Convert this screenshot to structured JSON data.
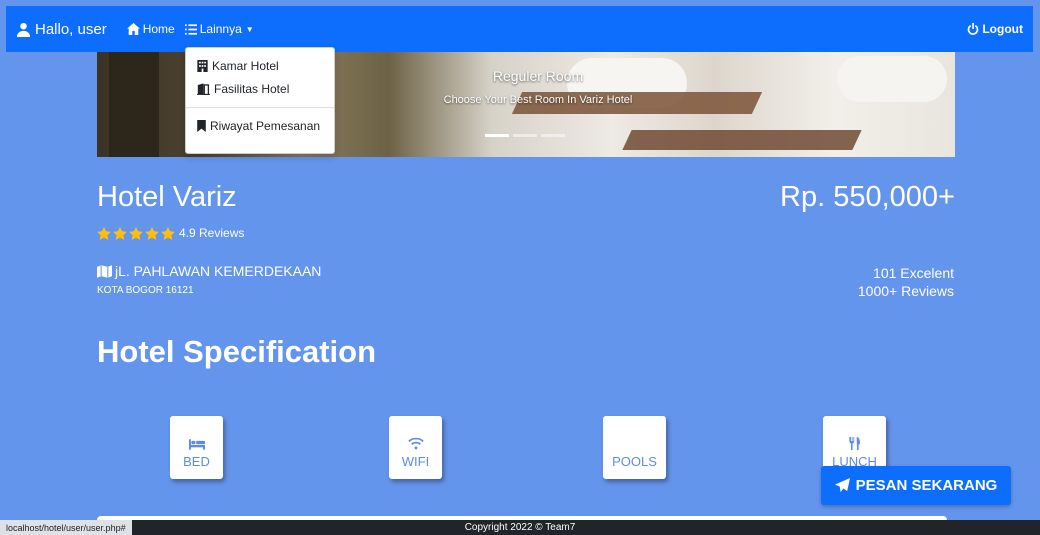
{
  "navbar": {
    "brand": "Hallo, user",
    "home": "Home",
    "more": "Lainnya",
    "logout": "Logout"
  },
  "dropdown": {
    "items": [
      "Kamar Hotel",
      "Fasilitas Hotel",
      "Riwayat Pemesanan"
    ]
  },
  "carousel": {
    "title": "Reguler Room",
    "subtitle": "Choose Your Best Room In Variz Hotel",
    "slide_count": 3,
    "active_slide": 1
  },
  "hotel": {
    "name": "Hotel Variz",
    "price": "Rp. 550,000+",
    "stars": 5,
    "rating_text": "4.9 Reviews",
    "address": "jL. PAHLAWAN KEMERDEKAAN",
    "city": "KOTA BOGOR 16121",
    "score": "101 Excelent",
    "reviews": "1000+ Reviews"
  },
  "specification": {
    "title": "Hotel Specification",
    "items": [
      {
        "label": "BED",
        "icon": "bed-icon"
      },
      {
        "label": "WIFI",
        "icon": "wifi-icon"
      },
      {
        "label": "POOLS",
        "icon": ""
      },
      {
        "label": "LUNCH",
        "icon": "utensils-icon"
      }
    ]
  },
  "cta": {
    "label": "PESAN SEKARANG"
  },
  "footer": {
    "copyright": "Copyright 2022 © Team7"
  },
  "statusbar": {
    "url": "localhost/hotel/user/user.php#"
  },
  "colors": {
    "navbar": "#0d6efd",
    "page": "#6495ed",
    "accent_text": "#5b8de6",
    "star": "#ffc107",
    "footer": "#212529"
  }
}
